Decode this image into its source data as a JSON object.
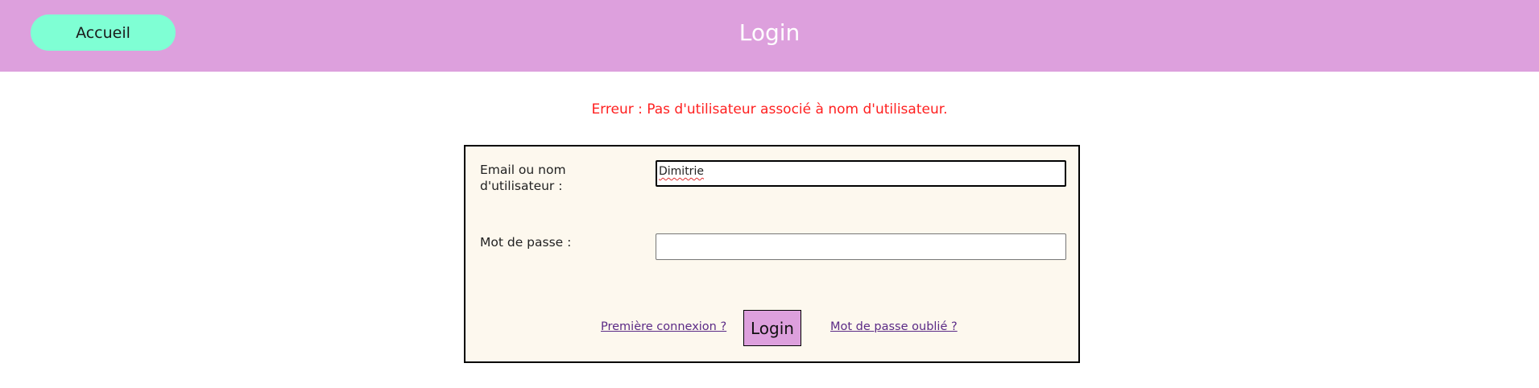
{
  "header": {
    "home_label": "Accueil",
    "title": "Login",
    "background_color": "#dda0dd",
    "home_button_color": "#7fffd4"
  },
  "error": {
    "message": "Erreur : Pas d'utilisateur associé à nom d'utilisateur.",
    "color": "#ff2020"
  },
  "form": {
    "username_label": "Email ou nom d'utilisateur :",
    "username_value": "Dimitrie",
    "password_label": "Mot de passe :",
    "password_value": "",
    "first_login_link": "Première connexion ?",
    "submit_label": "Login",
    "forgot_password_link": "Mot de passe oublié ?",
    "background_color": "#fdf8ee"
  }
}
